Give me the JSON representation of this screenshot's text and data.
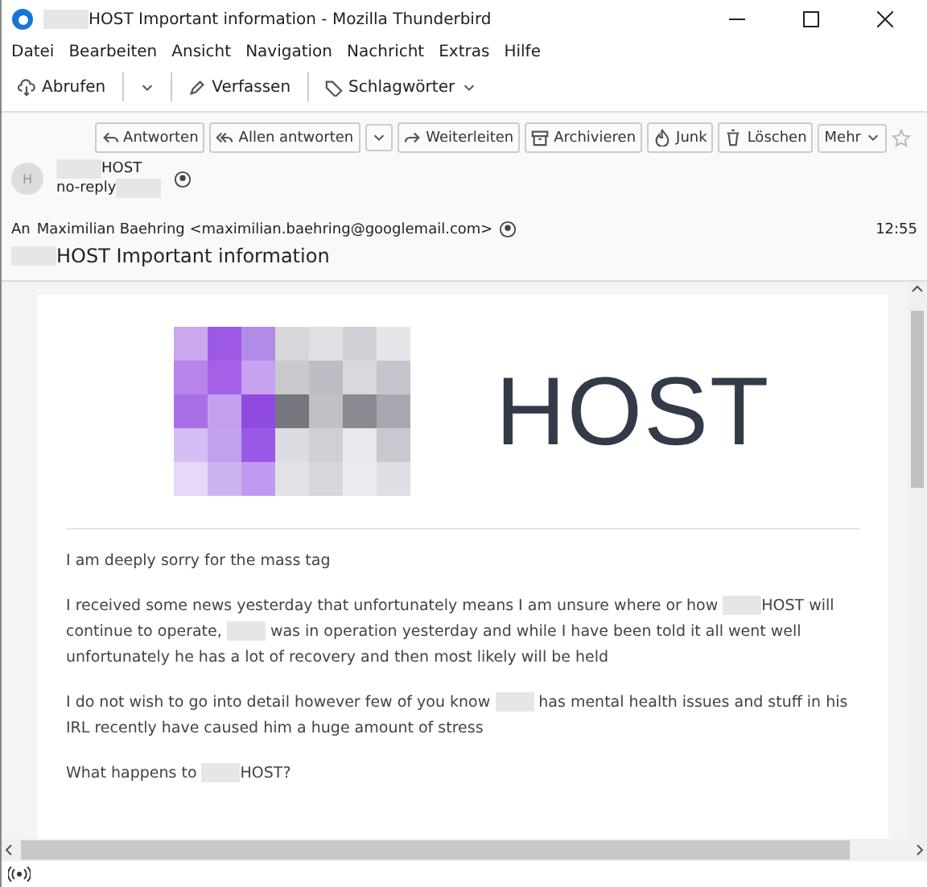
{
  "window": {
    "title": [
      {
        "kind": "redacted"
      },
      {
        "kind": "text",
        "text": "HOST Important information - Mozilla Thunderbird"
      }
    ]
  },
  "menu": [
    {
      "label": "Datei"
    },
    {
      "label": "Bearbeiten"
    },
    {
      "label": "Ansicht"
    },
    {
      "label": "Navigation"
    },
    {
      "label": "Nachricht"
    },
    {
      "label": "Extras"
    },
    {
      "label": "Hilfe"
    }
  ],
  "toolbar": [
    {
      "kind": "fetch",
      "label": "Abrufen"
    },
    {
      "kind": "compose",
      "label": "Verfassen"
    },
    {
      "kind": "tags",
      "label": "Schlagwörter"
    }
  ],
  "message_actions": [
    {
      "kind": "reply",
      "label": "Antworten"
    },
    {
      "kind": "reply-all",
      "label": "Allen antworten"
    },
    {
      "kind": "forward",
      "label": "Weiterleiten"
    },
    {
      "kind": "archive",
      "label": "Archivieren"
    },
    {
      "kind": "junk",
      "label": "Junk"
    },
    {
      "kind": "delete",
      "label": "Löschen"
    },
    {
      "kind": "more",
      "label": "Mehr"
    }
  ],
  "from": {
    "avatar": "H",
    "name": [
      {
        "kind": "redacted"
      },
      {
        "kind": "text",
        "text": "HOST"
      }
    ],
    "address": [
      {
        "kind": "text",
        "text": "no-reply"
      },
      {
        "kind": "redacted"
      }
    ]
  },
  "to": {
    "label": "An",
    "value": "Maximilian Baehring <maximilian.baehring@googlemail.com>",
    "time": "12:55"
  },
  "subject": [
    {
      "kind": "redacted"
    },
    {
      "kind": "text",
      "text": "HOST Important information"
    }
  ],
  "banner": {
    "text": "HOST"
  },
  "paragraphs": [
    {
      "parts": [
        {
          "kind": "text",
          "text": "I am deeply sorry for the mass tag"
        }
      ]
    },
    {
      "parts": [
        {
          "kind": "text",
          "text": "I received some news yesterday that unfortunately means I am unsure where or how "
        },
        {
          "kind": "redacted"
        },
        {
          "kind": "text",
          "text": "HOST will continue to operate, "
        },
        {
          "kind": "redacted"
        },
        {
          "kind": "text",
          "text": " was in operation yesterday and while I have been told it all went well unfortunately he has a lot of recovery and then most likely will be held"
        }
      ]
    },
    {
      "parts": [
        {
          "kind": "text",
          "text": "I do not wish to go into detail however few of you know "
        },
        {
          "kind": "redacted"
        },
        {
          "kind": "text",
          "text": " has mental health issues and stuff in his IRL recently have caused him a huge amount of stress"
        }
      ]
    },
    {
      "parts": [
        {
          "kind": "text",
          "text": "What happens to "
        },
        {
          "kind": "redacted"
        },
        {
          "kind": "text",
          "text": "HOST?"
        }
      ]
    }
  ]
}
